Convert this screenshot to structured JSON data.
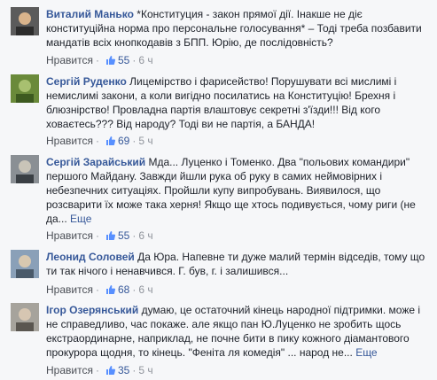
{
  "comments": [
    {
      "author": "Виталий Манько",
      "text": "*Конституция - закон прямої дії. Інакше не діє конституційна норма про персональне голосування* – Тоді треба позбавити мандатів всіх кнопкодавів з БПП. Юрію, де послідовність?",
      "like_label": "Нравится",
      "likes": "55",
      "time": "6 ч",
      "avatar_colors": [
        "#5b5b5b",
        "#d9b48c",
        "#2c2c2c"
      ]
    },
    {
      "author": "Сергій Руденко",
      "text": "Лицемірство і фарисейство! Порушувати всі мислимі і немислимі закони, а коли вигідно посилатись на Конституцію! Брехня і блюзнірство! Провладна партія влаштовує секретні з'їзди!!! Від кого ховаєтесь??? Від народу? Тоді ви не партія, а БАНДА!",
      "like_label": "Нравится",
      "likes": "69",
      "time": "5 ч",
      "avatar_colors": [
        "#6a8a3a",
        "#a8c070",
        "#3d5a20"
      ]
    },
    {
      "author": "Сергій Зарайський",
      "text": "Мда... Луценко і Томенко. Два \"польових командири\" першого Майдану. Завжди йшли рука об руку в самих неймовірних і небезпечних ситуаціях. Пройшли купу випробувань. Виявилося, що розсварити їх може така херня! Якщо ще хтось подивується, чому риги (не да...",
      "more": "Еще",
      "like_label": "Нравится",
      "likes": "55",
      "time": "6 ч",
      "avatar_colors": [
        "#8a8f94",
        "#c9c4b8",
        "#3a3f44"
      ]
    },
    {
      "author": "Леонид Соловей",
      "text": "Да Юра. Напевне ти дуже малий термін відседів, тому що ти так нічого і ненавчився. Г. був, г. і залишився...",
      "like_label": "Нравится",
      "likes": "68",
      "time": "6 ч",
      "avatar_colors": [
        "#8aa0b8",
        "#d8c8b0",
        "#4a5a6a"
      ]
    },
    {
      "author": "Ігор Озерянський",
      "text": "думаю, це остаточний кінець народної підтримки. може і не справедливо, час покаже. але якщо пан Ю.Луценко не зробить щось екстраординарне, наприклад, не почне бити в пику кожного діамантового прокурора щодня, то кінець. \"Феніта ля комедія\" ... народ не...",
      "more": "Еще",
      "like_label": "Нравится",
      "likes": "35",
      "time": "5 ч",
      "avatar_colors": [
        "#a6a39c",
        "#d6c6b2",
        "#5a5650"
      ]
    }
  ]
}
